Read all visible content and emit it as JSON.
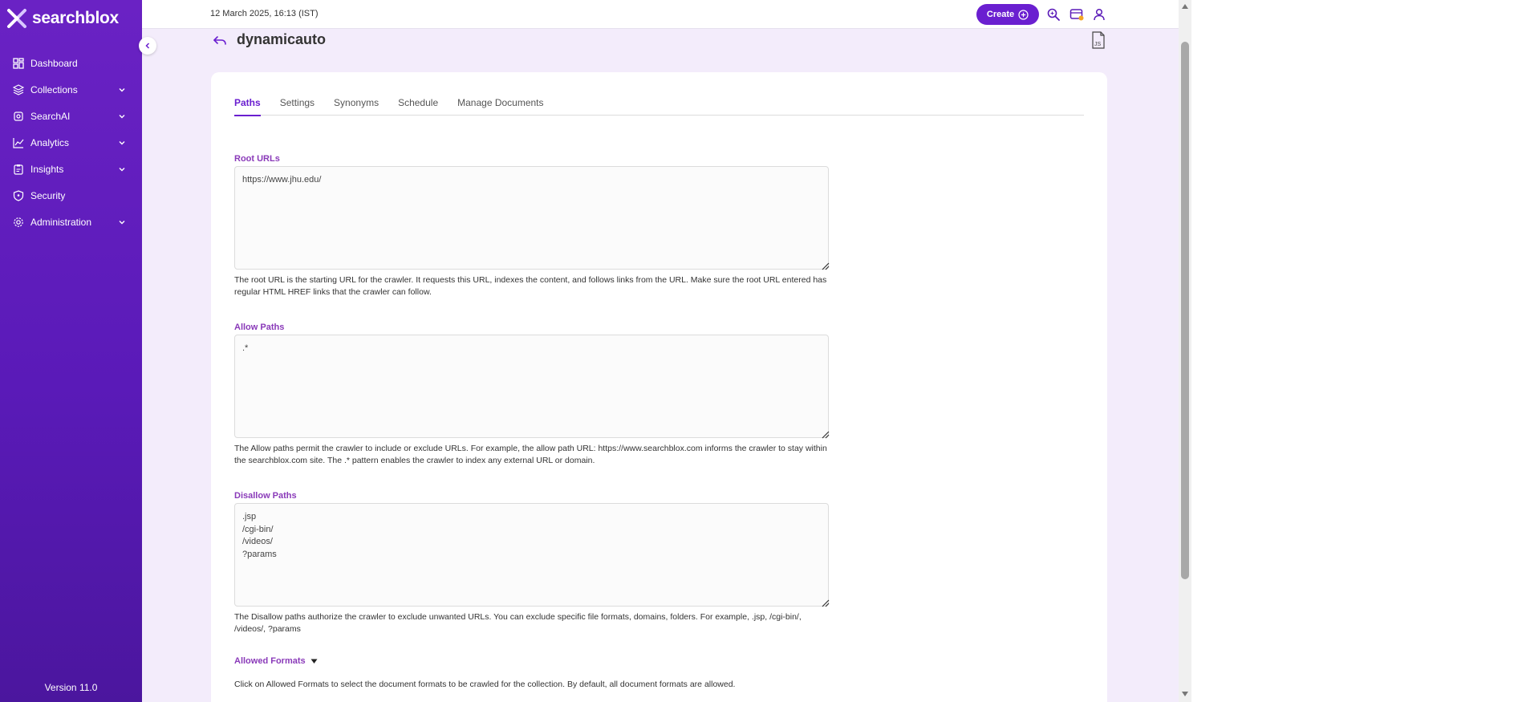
{
  "brand": {
    "name": "searchblox"
  },
  "sidebar": {
    "items": [
      {
        "label": "Dashboard",
        "icon": "dashboard-icon",
        "expandable": false
      },
      {
        "label": "Collections",
        "icon": "layers-icon",
        "expandable": true
      },
      {
        "label": "SearchAI",
        "icon": "ai-chip-icon",
        "expandable": true
      },
      {
        "label": "Analytics",
        "icon": "chart-icon",
        "expandable": true
      },
      {
        "label": "Insights",
        "icon": "clipboard-icon",
        "expandable": true
      },
      {
        "label": "Security",
        "icon": "shield-icon",
        "expandable": false
      },
      {
        "label": "Administration",
        "icon": "gear-icon",
        "expandable": true
      }
    ],
    "version": "Version 11.0"
  },
  "header": {
    "datetime": "12 March 2025, 16:13 (IST)",
    "create_label": "Create"
  },
  "page": {
    "title": "dynamicauto",
    "tabs": [
      "Paths",
      "Settings",
      "Synonyms",
      "Schedule",
      "Manage Documents"
    ],
    "active_tab": "Paths"
  },
  "paths": {
    "root_urls": {
      "label": "Root URLs",
      "value": "https://www.jhu.edu/",
      "help": "The root URL is the starting URL for the crawler. It requests this URL, indexes the content, and follows links from the URL. Make sure the root URL entered has regular HTML HREF links that the crawler can follow."
    },
    "allow_paths": {
      "label": "Allow Paths",
      "value": ".*",
      "help": "The Allow paths permit the crawler to include or exclude URLs. For example, the allow path URL: https://www.searchblox.com informs the crawler to stay within the searchblox.com site. The .* pattern enables the crawler to index any external URL or domain."
    },
    "disallow_paths": {
      "label": "Disallow Paths",
      "value": ".jsp\n/cgi-bin/\n/videos/\n?params",
      "help": "The Disallow paths authorize the crawler to exclude unwanted URLs. You can exclude specific file formats, domains, folders. For example, .jsp, /cgi-bin/, /videos/, ?params"
    },
    "allowed_formats": {
      "label": "Allowed Formats",
      "help": "Click on Allowed Formats to select the document formats to be crawled for the collection. By default, all document formats are allowed."
    }
  },
  "colors": {
    "sidebar": "#5a1ab8",
    "accent": "#6a1fd0",
    "section_label": "#8a3ab9",
    "main_bg": "#f3ecfb"
  }
}
